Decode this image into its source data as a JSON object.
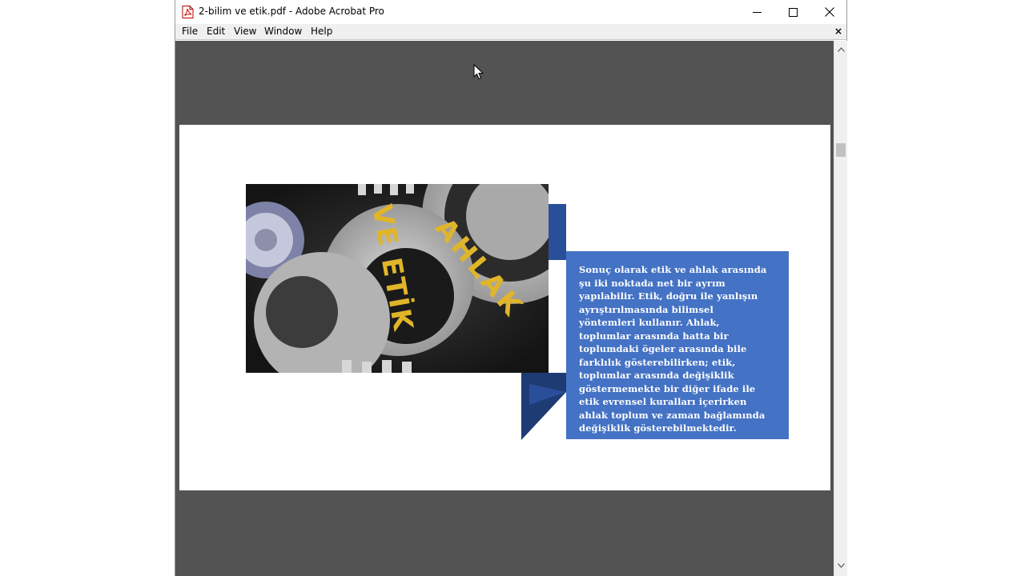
{
  "window": {
    "title": "2-bilim ve etik.pdf - Adobe Acrobat Pro"
  },
  "menu": {
    "file": "File",
    "edit": "Edit",
    "view": "View",
    "window": "Window",
    "help": "Help",
    "close": "×"
  },
  "document": {
    "image_words": [
      "VE ETİK",
      "AHLAK"
    ],
    "body_text": "Sonuç olarak etik ve ahlak arasında şu iki noktada net bir ayrım yapılabilir. Etik, doğru ile yanlışın ayrıştırılmasında bilimsel yöntemleri kullanır. Ahlak, toplumlar arasında hatta bir toplumdaki ögeler arasında bile farklılık gösterebilirken; etik, toplumlar arasında değişiklik göstermemekte bir diğer ifade ile etik evrensel kuralları içerirken ahlak toplum ve zaman bağlamında değişiklik gösterebilmektedir."
  },
  "colors": {
    "viewport_bg": "#535353",
    "textbox_bg": "#4472c4",
    "ribbon_dark": "#1f3b73",
    "gear_text": "#e0b52a"
  },
  "icons": {
    "app": "pdf-file-icon",
    "minimize": "minimize-icon",
    "maximize": "maximize-icon",
    "close": "close-icon"
  }
}
